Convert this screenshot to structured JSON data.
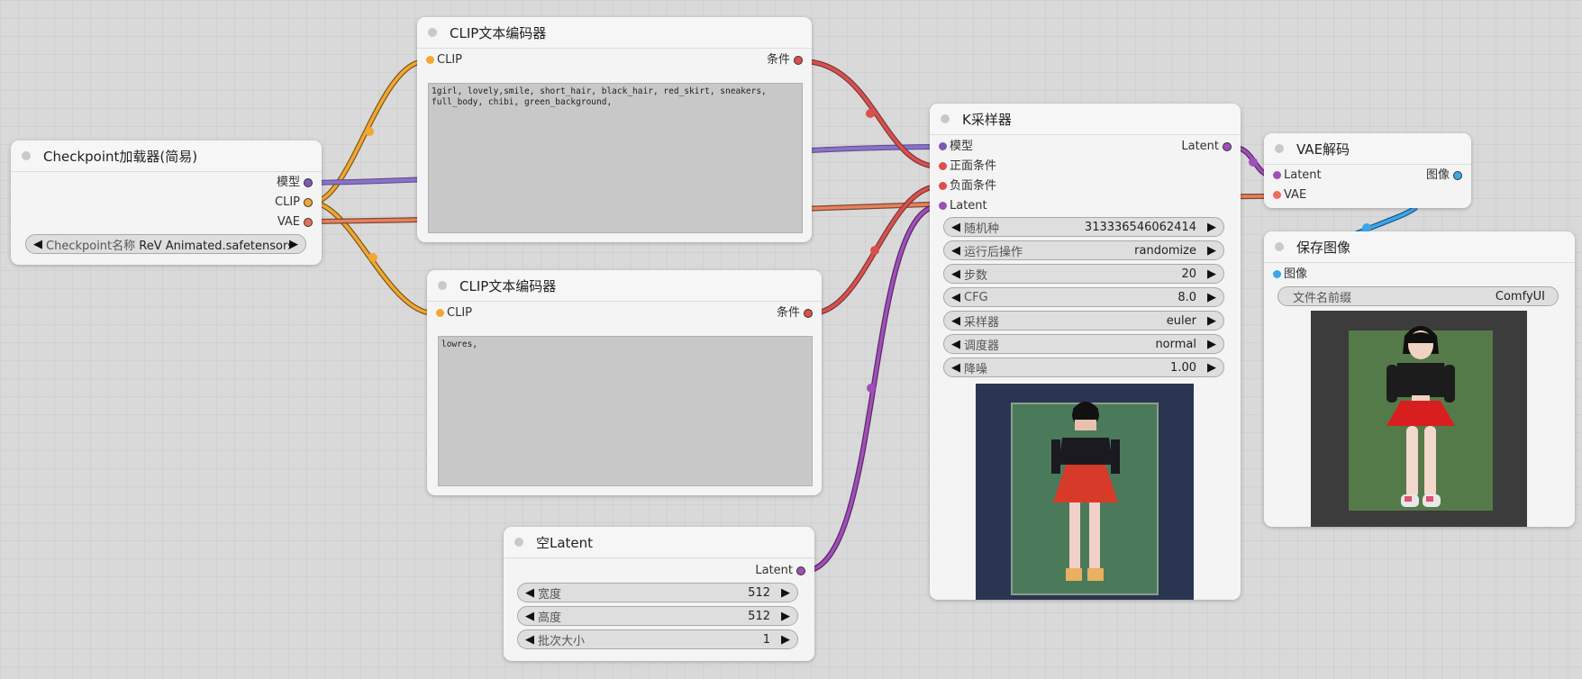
{
  "colors": {
    "model": "#7b5ab8",
    "clip": "#f3a632",
    "vae": "#e8705a",
    "conditioning": "#dc4f4f",
    "latent": "#a14fb8",
    "image": "#3da6e8"
  },
  "checkpoint_loader": {
    "title": "Checkpoint加载器(简易)",
    "outputs": [
      "模型",
      "CLIP",
      "VAE"
    ],
    "ckpt_label": "Checkpoint名称",
    "ckpt_value": "ReV Animated.safetensors"
  },
  "clip_text_positive": {
    "title": "CLIP文本编码器",
    "input": "CLIP",
    "output": "条件",
    "text": "1girl, lovely,smile, short_hair, black_hair, red_skirt, sneakers, full_body, chibi, green_background,"
  },
  "clip_text_negative": {
    "title": "CLIP文本编码器",
    "input": "CLIP",
    "output": "条件",
    "text": "lowres,"
  },
  "empty_latent": {
    "title": "空Latent",
    "output": "Latent",
    "widgets": [
      {
        "label": "宽度",
        "value": "512"
      },
      {
        "label": "高度",
        "value": "512"
      },
      {
        "label": "批次大小",
        "value": "1"
      }
    ]
  },
  "ksampler": {
    "title": "K采样器",
    "inputs": [
      "模型",
      "正面条件",
      "负面条件",
      "Latent"
    ],
    "output": "Latent",
    "widgets": [
      {
        "label": "随机种",
        "value": "313336546062414"
      },
      {
        "label": "运行后操作",
        "value": "randomize"
      },
      {
        "label": "步数",
        "value": "20"
      },
      {
        "label": "CFG",
        "value": "8.0"
      },
      {
        "label": "采样器",
        "value": "euler"
      },
      {
        "label": "调度器",
        "value": "normal"
      },
      {
        "label": "降噪",
        "value": "1.00"
      }
    ]
  },
  "vae_decode": {
    "title": "VAE解码",
    "inputs": [
      "Latent",
      "VAE"
    ],
    "output": "图像"
  },
  "save_image": {
    "title": "保存图像",
    "input": "图像",
    "prefix_label": "文件名前缀",
    "prefix_value": "ComfyUI"
  },
  "icons": {
    "decrement": "◀",
    "increment": "▶",
    "status_dot": "node-status-dot"
  }
}
